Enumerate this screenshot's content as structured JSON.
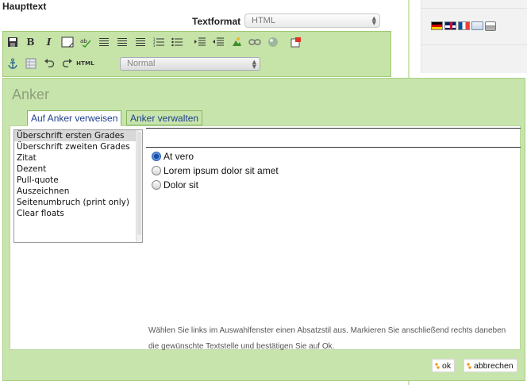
{
  "page": {
    "heading": "Haupttext",
    "format_label": "Textformat",
    "format_value": "HTML"
  },
  "language_icons": [
    "flag-de-icon",
    "flag-en-icon",
    "flag-fr-icon",
    "email-icon",
    "print-icon"
  ],
  "toolbar": {
    "row1": [
      "save-icon",
      "bold-icon",
      "italic-icon",
      "border-icon",
      "spellcheck-icon",
      "align-left-icon",
      "align-center-icon",
      "align-right-icon",
      "ordered-list-icon",
      "unordered-list-icon",
      "indent-icon",
      "outdent-icon",
      "insert-image-icon",
      "insert-link-icon",
      "insert-object-icon",
      "fullscreen-icon"
    ],
    "row2": [
      "anchor-icon",
      "table-icon",
      "undo-icon",
      "redo-icon",
      "html-icon"
    ],
    "bold_glyph": "B",
    "italic_glyph": "I",
    "html_label": "HTML",
    "style_value": "Normal"
  },
  "dialog": {
    "title": "Anker",
    "tabs": [
      {
        "label": "Auf Anker verweisen",
        "active": true
      },
      {
        "label": "Anker verwalten",
        "active": false
      }
    ],
    "styles": [
      "Überschrift ersten Grades",
      "Überschrift zweiten Grades",
      "Zitat",
      "Dezent",
      "Pull-quote",
      "Auszeichnen",
      "Seitenumbruch (print only)",
      "Clear floats"
    ],
    "selected_style_index": 0,
    "radio_options": [
      {
        "label": "At vero",
        "checked": true
      },
      {
        "label": "Lorem ipsum dolor sit amet",
        "checked": false
      },
      {
        "label": "Dolor sit",
        "checked": false
      }
    ],
    "help_text": "Wählen Sie links im Auswahlfenster einen Absatzstil aus. Markieren Sie anschließend rechts daneben die gewünschte Textstelle und bestätigen Sie auf Ok.",
    "ok_label": "ok",
    "cancel_label": "abbrechen"
  },
  "colors": {
    "toolbar_bg": "#c6e3a8",
    "dialog_bg": "#c8e4ad",
    "tab_text": "#1e3f8e",
    "accent_orange": "#f29a1e"
  }
}
